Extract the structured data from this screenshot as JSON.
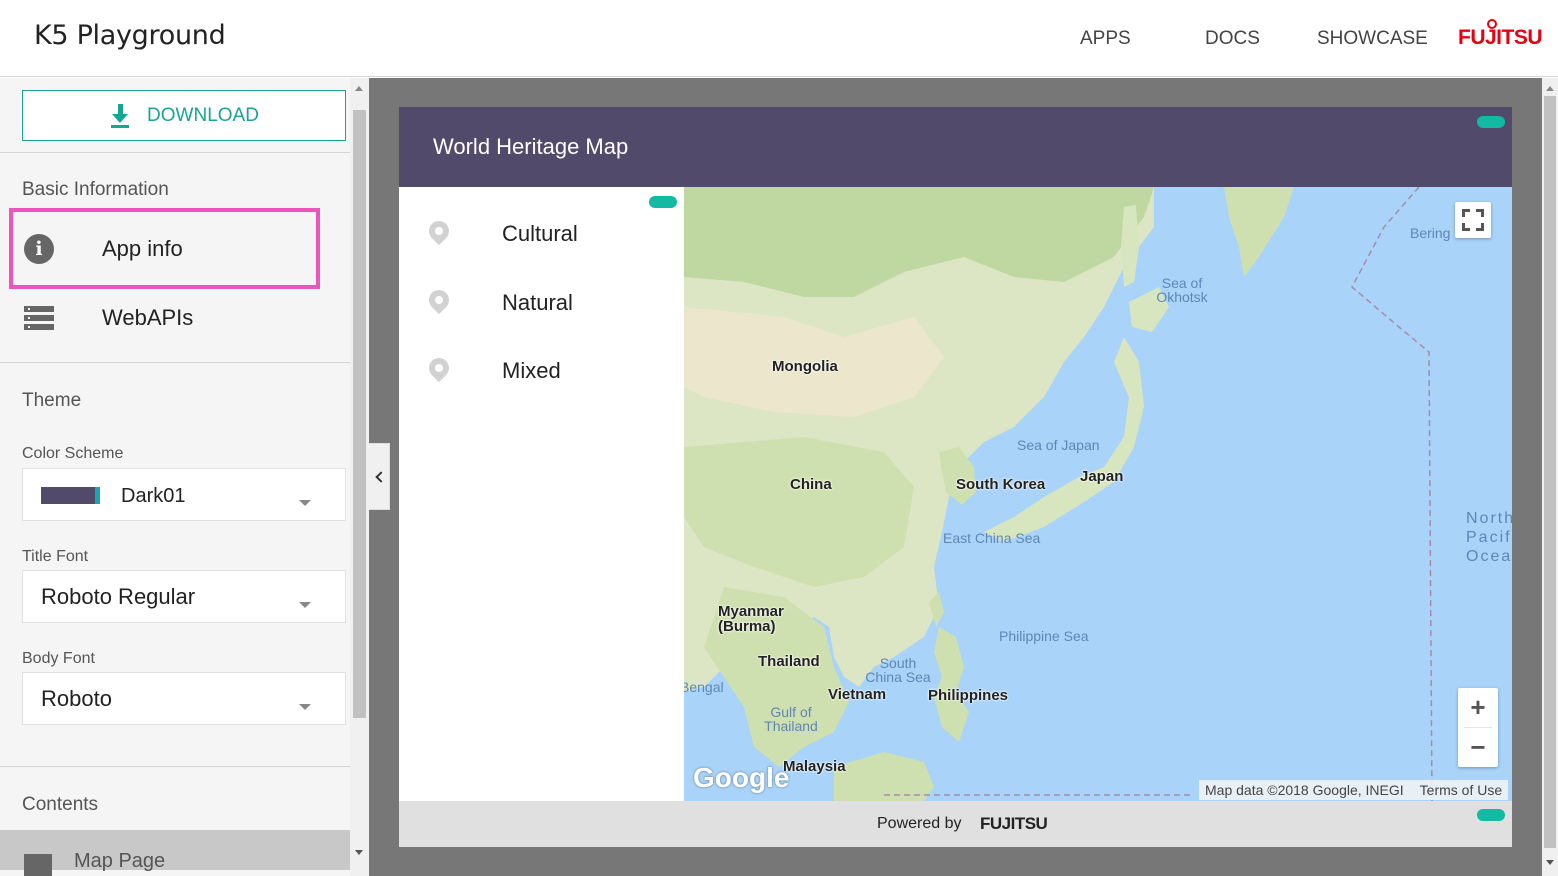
{
  "topbar": {
    "brand": "K5 Playground",
    "nav": [
      "APPS",
      "DOCS",
      "SHOWCASE"
    ],
    "logo_text": "FUJITSU"
  },
  "sidebar": {
    "download_label": "DOWNLOAD",
    "basic_information": "Basic Information",
    "items": [
      {
        "label": "App info",
        "icon": "info-icon"
      },
      {
        "label": "WebAPIs",
        "icon": "list-icon"
      }
    ],
    "theme_title": "Theme",
    "color_scheme_label": "Color Scheme",
    "color_scheme_value": "Dark01",
    "title_font_label": "Title Font",
    "title_font_value": "Roboto Regular",
    "body_font_label": "Body Font",
    "body_font_value": "Roboto",
    "contents_title": "Contents",
    "contents_item": "Map Page"
  },
  "app": {
    "title": "World Heritage Map",
    "categories": [
      "Cultural",
      "Natural",
      "Mixed"
    ],
    "footer_powered": "Powered by",
    "footer_logo": "FUJITSU"
  },
  "map": {
    "countries": [
      "Mongolia",
      "China",
      "South Korea",
      "Japan",
      "Myanmar (Burma)",
      "Thailand",
      "Vietnam",
      "Philippines",
      "Malaysia"
    ],
    "seas": [
      "Sea of Okhotsk",
      "Sea of Japan",
      "East China Sea",
      "Philippine Sea",
      "South China Sea",
      "Gulf of Thailand",
      "Bering Sea",
      "Bengal"
    ],
    "ocean": "North Pacific Ocean",
    "google": "Google",
    "attribution": "Map data ©2018 Google, INEGI",
    "terms": "Terms of Use",
    "zoom_in": "+",
    "zoom_out": "−"
  },
  "colors": {
    "accent": "#19a594",
    "header": "#524a6a",
    "brand_red": "#e60012",
    "highlight": "#ee55bb"
  }
}
